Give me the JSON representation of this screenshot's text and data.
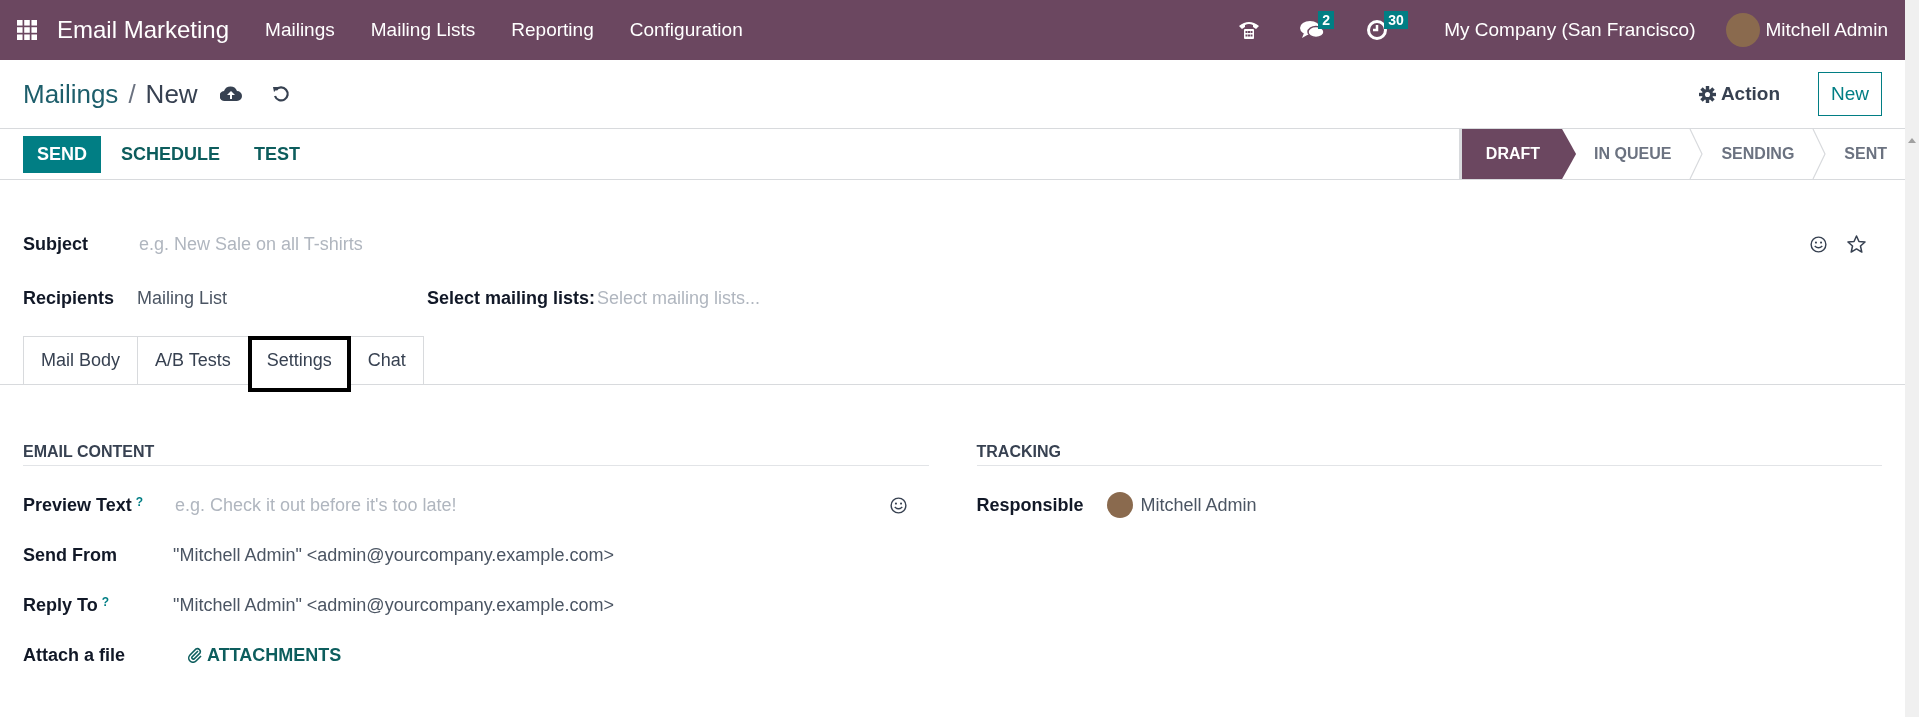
{
  "navbar": {
    "app_name": "Email Marketing",
    "menu": [
      "Mailings",
      "Mailing Lists",
      "Reporting",
      "Configuration"
    ],
    "messages_count": "2",
    "activities_count": "30",
    "company": "My Company (San Francisco)",
    "user": "Mitchell Admin"
  },
  "control_panel": {
    "breadcrumb_parent": "Mailings",
    "breadcrumb_separator": "/",
    "breadcrumb_current": "New",
    "action": "Action",
    "new_button": "New"
  },
  "buttons": [
    {
      "label": "SEND",
      "kind": "primary"
    },
    {
      "label": "SCHEDULE",
      "kind": "link"
    },
    {
      "label": "TEST",
      "kind": "link"
    }
  ],
  "stages": [
    {
      "label": "DRAFT",
      "selected": true
    },
    {
      "label": "IN QUEUE",
      "selected": false
    },
    {
      "label": "SENDING",
      "selected": false
    },
    {
      "label": "SENT",
      "selected": false
    }
  ],
  "form": {
    "subject_label": "Subject",
    "subject_placeholder": "e.g. New Sale on all T-shirts",
    "recipients_label": "Recipients",
    "recipients_value": "Mailing List",
    "lists_label": "Select mailing lists:",
    "lists_placeholder": "Select mailing lists..."
  },
  "tabs": [
    {
      "label": "Mail Body",
      "selected": false
    },
    {
      "label": "A/B Tests",
      "selected": false
    },
    {
      "label": "Settings",
      "selected": true
    },
    {
      "label": "Chat",
      "selected": false
    }
  ],
  "email_content": {
    "title": "EMAIL CONTENT",
    "fields": [
      {
        "label": "Preview Text",
        "help": "?",
        "kind": "placeholder",
        "placeholder": "e.g. Check it out before it's too late!"
      },
      {
        "label": "Send From",
        "kind": "value",
        "value": "\"Mitchell Admin\" <admin@yourcompany.example.com>"
      },
      {
        "label": "Reply To",
        "help": "?",
        "kind": "value",
        "value": "\"Mitchell Admin\" <admin@yourcompany.example.com>"
      },
      {
        "label": "Attach a file",
        "kind": "attachment",
        "value": "ATTACHMENTS"
      }
    ]
  },
  "tracking": {
    "title": "TRACKING",
    "responsible_label": "Responsible",
    "responsible_value": "Mitchell Admin"
  }
}
